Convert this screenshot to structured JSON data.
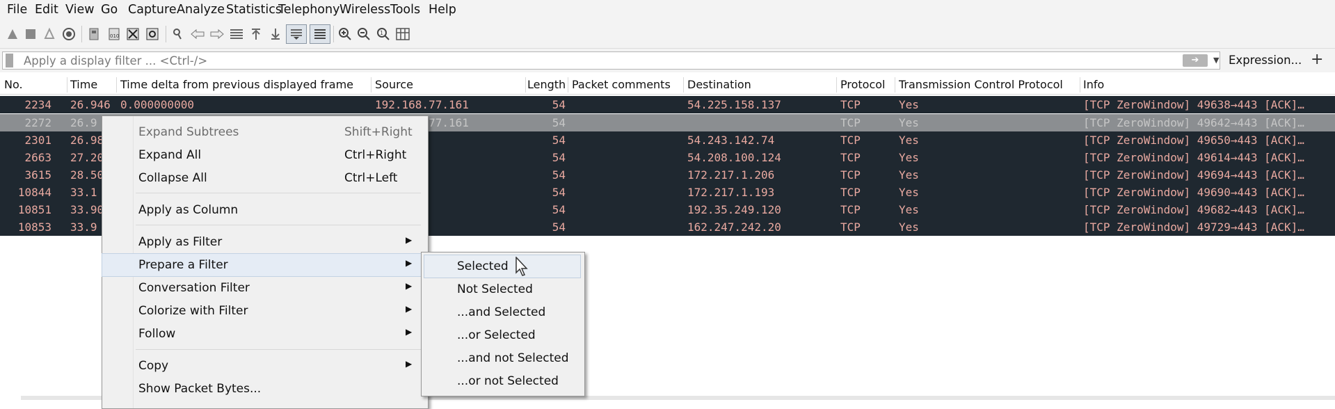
{
  "menubar": [
    "File",
    "Edit",
    "View",
    "Go",
    "Capture",
    "Analyze",
    "Statistics",
    "Telephony",
    "Wireless",
    "Tools",
    "Help"
  ],
  "toolbar_icons": [
    "start-capture-icon",
    "stop-capture-icon",
    "restart-capture-icon",
    "capture-options-icon",
    "open-file-icon",
    "save-file-icon",
    "close-file-icon",
    "reload-file-icon",
    "find-packet-icon",
    "go-back-icon",
    "go-forward-icon",
    "go-to-packet-icon",
    "go-first-packet-icon",
    "go-last-packet-icon",
    "auto-scroll-icon",
    "colorize-icon",
    "zoom-in-icon",
    "zoom-out-icon",
    "normal-size-icon",
    "resize-columns-icon"
  ],
  "filter": {
    "placeholder": "Apply a display filter ... <Ctrl-/>",
    "expression_label": "Expression...",
    "add_label": "+"
  },
  "columns": [
    "No.",
    "Time",
    "Time delta from previous displayed frame",
    "Source",
    "Length",
    "Packet comments",
    "Destination",
    "Protocol",
    "Transmission Control Protocol",
    "Info"
  ],
  "rows": [
    {
      "no": "2234",
      "time": "26.946",
      "delta": "0.000000000",
      "src": "192.168.77.161",
      "len": "54",
      "dst": "54.225.158.137",
      "proto": "TCP",
      "tcp": "Yes",
      "info": "[TCP ZeroWindow] 49638→443 [ACK]…"
    },
    {
      "no": "2272",
      "time": "26.9",
      "delta": "",
      "src": "192.168.77.161",
      "len": "54",
      "dst": "",
      "proto": "TCP",
      "tcp": "Yes",
      "info": "[TCP ZeroWindow] 49642→443 [ACK]…"
    },
    {
      "no": "2301",
      "time": "26.98",
      "delta": "",
      "src": ".77.161",
      "len": "54",
      "dst": "54.243.142.74",
      "proto": "TCP",
      "tcp": "Yes",
      "info": "[TCP ZeroWindow] 49650→443 [ACK]…"
    },
    {
      "no": "2663",
      "time": "27.20",
      "delta": "",
      "src": ".77.161",
      "len": "54",
      "dst": "54.208.100.124",
      "proto": "TCP",
      "tcp": "Yes",
      "info": "[TCP ZeroWindow] 49614→443 [ACK]…"
    },
    {
      "no": "3615",
      "time": "28.50",
      "delta": "",
      "src": ".77.161",
      "len": "54",
      "dst": "172.217.1.206",
      "proto": "TCP",
      "tcp": "Yes",
      "info": "[TCP ZeroWindow] 49694→443 [ACK]…"
    },
    {
      "no": "10844",
      "time": "33.1",
      "delta": "",
      "src": ".77.161",
      "len": "54",
      "dst": "172.217.1.193",
      "proto": "TCP",
      "tcp": "Yes",
      "info": "[TCP ZeroWindow] 49690→443 [ACK]…"
    },
    {
      "no": "10851",
      "time": "33.90",
      "delta": "",
      "src": ".77.161",
      "len": "54",
      "dst": "192.35.249.120",
      "proto": "TCP",
      "tcp": "Yes",
      "info": "[TCP ZeroWindow] 49682→443 [ACK]…"
    },
    {
      "no": "10853",
      "time": "33.9",
      "delta": "",
      "src": ".77.161",
      "len": "54",
      "dst": "162.247.242.20",
      "proto": "TCP",
      "tcp": "Yes",
      "info": "[TCP ZeroWindow] 49729→443 [ACK]…"
    }
  ],
  "context_menu": {
    "expand_subtrees": "Expand Subtrees",
    "expand_subtrees_sc": "Shift+Right",
    "expand_all": "Expand All",
    "expand_all_sc": "Ctrl+Right",
    "collapse_all": "Collapse All",
    "collapse_all_sc": "Ctrl+Left",
    "apply_as_column": "Apply as Column",
    "apply_as_filter": "Apply as Filter",
    "prepare_a_filter": "Prepare a Filter",
    "conversation_filter": "Conversation Filter",
    "colorize_with_filter": "Colorize with Filter",
    "follow": "Follow",
    "copy": "Copy",
    "show_packet_bytes": "Show Packet Bytes..."
  },
  "submenu": [
    "Selected",
    "Not Selected",
    "...and Selected",
    "...or Selected",
    "...and not Selected",
    "...or not Selected"
  ]
}
